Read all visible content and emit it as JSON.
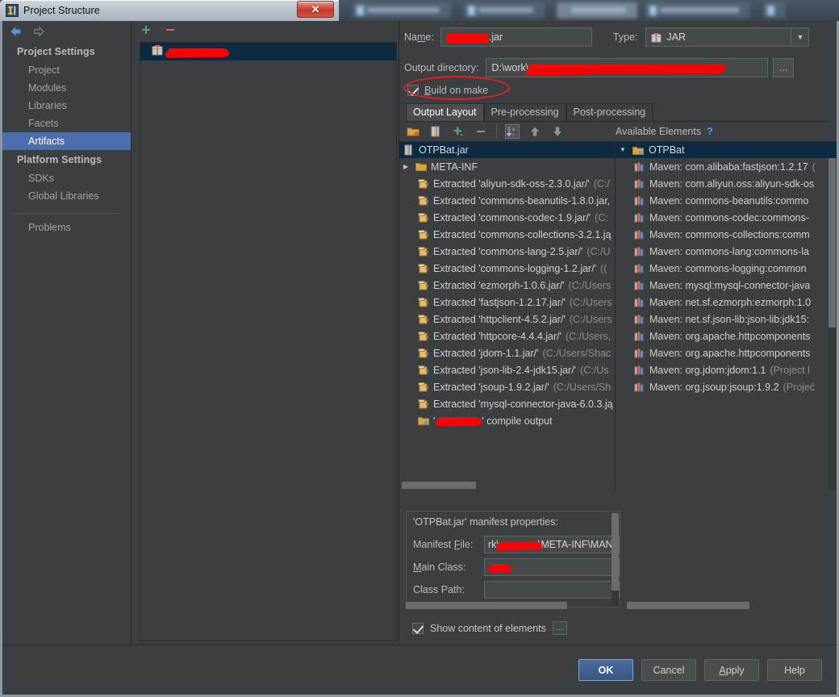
{
  "window": {
    "title": "Project Structure",
    "title_icon": "intellij-logo-icon",
    "close_label": "✕"
  },
  "nav": {
    "back_icon": "arrow-back-icon",
    "forward_icon": "arrow-forward-icon"
  },
  "sidebar": {
    "groups": [
      {
        "label": "Project Settings",
        "items": [
          {
            "label": "Project",
            "selected": false
          },
          {
            "label": "Modules",
            "selected": false
          },
          {
            "label": "Libraries",
            "selected": false
          },
          {
            "label": "Facets",
            "selected": false
          },
          {
            "label": "Artifacts",
            "selected": true
          }
        ]
      },
      {
        "label": "Platform Settings",
        "items": [
          {
            "label": "SDKs",
            "selected": false
          },
          {
            "label": "Global Libraries",
            "selected": false
          }
        ]
      }
    ],
    "problems": "Problems"
  },
  "artifacts": {
    "add_icon": "plus-icon",
    "remove_icon": "minus-icon",
    "selected_row_icon": "jar-artifact-icon",
    "selected_row_label_redacted": true
  },
  "detail": {
    "name_label": "Name:",
    "name_value_suffix": ".jar",
    "type_label": "Type:",
    "type_value": "JAR",
    "type_icon": "jar-artifact-icon",
    "output_label": "Output directory:",
    "output_value_prefix": "D:\\work\\",
    "browse_label": "...",
    "build_on_make_label": "Build on make",
    "build_on_make_checked": true,
    "annotation_shape": "red-ellipse",
    "tabs": [
      {
        "label": "Output Layout",
        "active": true
      },
      {
        "label": "Pre-processing",
        "active": false
      },
      {
        "label": "Post-processing",
        "active": false
      }
    ]
  },
  "layout_toolbar": {
    "buttons": [
      {
        "name": "add-directory-icon",
        "toggled": false
      },
      {
        "name": "add-archive-icon",
        "toggled": false
      },
      {
        "name": "plus-icon",
        "toggled": false
      },
      {
        "name": "minus-icon",
        "toggled": false
      },
      {
        "name": "sort-alphabetically-icon",
        "toggled": true
      },
      {
        "name": "move-up-icon",
        "toggled": false
      },
      {
        "name": "move-down-icon",
        "toggled": false
      }
    ],
    "available_elements_label": "Available Elements",
    "help_label": "?"
  },
  "output_tree": {
    "root": {
      "label": "OTPBat.jar",
      "icon": "jar-artifact-icon"
    },
    "rows": [
      {
        "icon": "folder-icon",
        "twisty": "▶",
        "name": "META-INF",
        "path": ""
      },
      {
        "icon": "extracted-jar-icon",
        "name": "Extracted 'aliyun-sdk-oss-2.3.0.jar/'",
        "path": "(C:/"
      },
      {
        "icon": "extracted-jar-icon",
        "name": "Extracted 'commons-beanutils-1.8.0.jar,",
        "path": ""
      },
      {
        "icon": "extracted-jar-icon",
        "name": "Extracted 'commons-codec-1.9.jar/'",
        "path": "(C:"
      },
      {
        "icon": "extracted-jar-icon",
        "name": "Extracted 'commons-collections-3.2.1.ją",
        "path": ""
      },
      {
        "icon": "extracted-jar-icon",
        "name": "Extracted 'commons-lang-2.5.jar/'",
        "path": "(C:/U"
      },
      {
        "icon": "extracted-jar-icon",
        "name": "Extracted 'commons-logging-1.2.jar/'",
        "path": "(("
      },
      {
        "icon": "extracted-jar-icon",
        "name": "Extracted 'ezmorph-1.0.6.jar/'",
        "path": "(C:/Users"
      },
      {
        "icon": "extracted-jar-icon",
        "name": "Extracted 'fastjson-1.2.17.jar/'",
        "path": "(C:/Users"
      },
      {
        "icon": "extracted-jar-icon",
        "name": "Extracted 'httpclient-4.5.2.jar/'",
        "path": "(C:/Users"
      },
      {
        "icon": "extracted-jar-icon",
        "name": "Extracted 'httpcore-4.4.4.jar/'",
        "path": "(C:/Users,"
      },
      {
        "icon": "extracted-jar-icon",
        "name": "Extracted 'jdom-1.1.jar/'",
        "path": "(C:/Users/Shac"
      },
      {
        "icon": "extracted-jar-icon",
        "name": "Extracted 'json-lib-2.4-jdk15.jar/'",
        "path": "(C:/Us"
      },
      {
        "icon": "extracted-jar-icon",
        "name": "Extracted 'jsoup-1.9.2.jar/'",
        "path": "(C:/Users/Sh"
      },
      {
        "icon": "extracted-jar-icon",
        "name": "Extracted 'mysql-connector-java-6.0.3.ją",
        "path": ""
      },
      {
        "icon": "module-output-icon",
        "name": "' ' compile output",
        "path": "",
        "redacted": true
      }
    ]
  },
  "available_tree": {
    "root": {
      "label": "OTPBat",
      "icon": "module-output-icon",
      "twisty": "▼"
    },
    "rows": [
      {
        "icon": "maven-library-icon",
        "name": "Maven: com.alibaba:fastjson:1.2.17",
        "path": "("
      },
      {
        "icon": "maven-library-icon",
        "name": "Maven: com.aliyun.oss:aliyun-sdk-os",
        "path": ""
      },
      {
        "icon": "maven-library-icon",
        "name": "Maven: commons-beanutils:commo",
        "path": ""
      },
      {
        "icon": "maven-library-icon",
        "name": "Maven: commons-codec:commons-",
        "path": ""
      },
      {
        "icon": "maven-library-icon",
        "name": "Maven: commons-collections:comm",
        "path": ""
      },
      {
        "icon": "maven-library-icon",
        "name": "Maven: commons-lang:commons-la",
        "path": ""
      },
      {
        "icon": "maven-library-icon",
        "name": "Maven: commons-logging:common",
        "path": ""
      },
      {
        "icon": "maven-library-icon",
        "name": "Maven: mysql:mysql-connector-java",
        "path": ""
      },
      {
        "icon": "maven-library-icon",
        "name": "Maven: net.sf.ezmorph:ezmorph:1.0",
        "path": ""
      },
      {
        "icon": "maven-library-icon",
        "name": "Maven: net.sf.json-lib:json-lib:jdk15:",
        "path": ""
      },
      {
        "icon": "maven-library-icon",
        "name": "Maven: org.apache.httpcomponents",
        "path": ""
      },
      {
        "icon": "maven-library-icon",
        "name": "Maven: org.apache.httpcomponents",
        "path": ""
      },
      {
        "icon": "maven-library-icon",
        "name": "Maven: org.jdom:jdom:1.1",
        "path": "(Project l"
      },
      {
        "icon": "maven-library-icon",
        "name": "Maven: org.jsoup:jsoup:1.9.2",
        "path": "(Projeć"
      }
    ]
  },
  "manifest": {
    "title": "'OTPBat.jar' manifest properties:",
    "manifest_file_label": "Manifest File:",
    "manifest_file_value_prefix": "rk\\",
    "manifest_file_value_suffix": "\\META-INF\\MAN",
    "main_class_label": "Main Class:",
    "main_class_redacted": true,
    "class_path_label": "Class Path:",
    "class_path_value": "",
    "show_content_label": "Show content of elements",
    "show_content_checked": true,
    "dots_label": "..."
  },
  "footer": {
    "buttons": [
      {
        "label": "OK",
        "default": true
      },
      {
        "label": "Cancel",
        "default": false
      },
      {
        "label": "Apply",
        "default": false
      },
      {
        "label": "Help",
        "default": false
      }
    ]
  },
  "colors": {
    "accent": "#4b6eaf",
    "selection": "#0d2a40",
    "redaction": "#fb0505",
    "annotation": "#ee1c1c",
    "background": "#3c3f41"
  }
}
